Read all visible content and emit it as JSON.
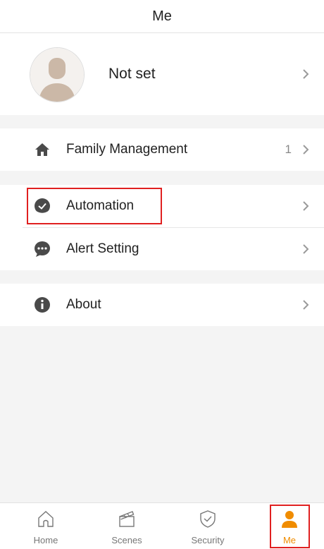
{
  "header": {
    "title": "Me"
  },
  "profile": {
    "name": "Not set"
  },
  "menu": {
    "family": {
      "label": "Family Management",
      "count": "1"
    },
    "automation": {
      "label": "Automation"
    },
    "alert": {
      "label": "Alert Setting"
    },
    "about": {
      "label": "About"
    }
  },
  "tabs": [
    {
      "label": "Home"
    },
    {
      "label": "Scenes"
    },
    {
      "label": "Security"
    },
    {
      "label": "Me"
    }
  ],
  "colors": {
    "accent": "#f08c00",
    "highlight": "#e02020"
  }
}
